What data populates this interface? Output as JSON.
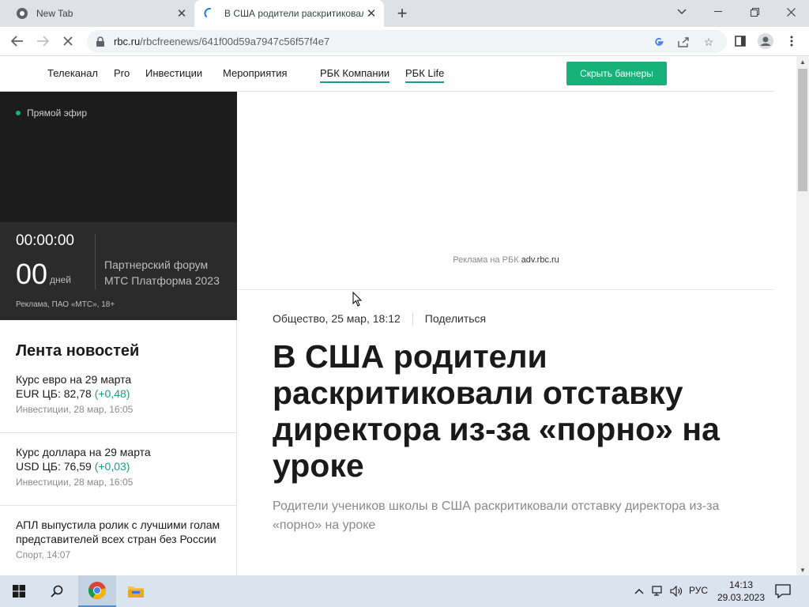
{
  "browser": {
    "tabs": [
      {
        "title": "New Tab",
        "active": false
      },
      {
        "title": "В США родители раскритиковали",
        "active": true
      }
    ],
    "url_host": "rbc.ru",
    "url_path": "/rbcfreenews/641f00d59a7947c56f57f4e7"
  },
  "site": {
    "nav": [
      "Телеканал",
      "Pro",
      "Инвестиции",
      "Мероприятия",
      "РБК Компании",
      "РБК Life"
    ],
    "hide_banners_label": "Скрыть баннеры",
    "live_label": "Прямой эфир",
    "countdown": {
      "time": "00:00:00",
      "days": "00",
      "days_label": "дней",
      "partner_line1": "Партнерский форум",
      "partner_line2": "МТС Платформа 2023",
      "ad_note": "Реклама, ПАО «МТС», 18+"
    },
    "feed_title": "Лента новостей",
    "feed": [
      {
        "line1": "Курс евро на 29 марта",
        "line2_main": "EUR ЦБ: 82,78",
        "line2_change": "(+0,48)",
        "meta": "Инвестиции, 28 мар, 16:05"
      },
      {
        "line1": "Курс доллара на 29 марта",
        "line2_main": "USD ЦБ: 76,59",
        "line2_change": "(+0,03)",
        "meta": "Инвестиции, 28 мар, 16:05"
      },
      {
        "line1": "АПЛ выпустила ролик с лучшими голам",
        "line2_main": "представителей всех стран без России",
        "line2_change": "",
        "meta": "Спорт, 14:07"
      }
    ],
    "ad_caption": "Реклама на РБК",
    "ad_link": "adv.rbc.ru",
    "article": {
      "category_date": "Общество, 25 мар, 18:12",
      "share_label": "Поделиться",
      "headline": "В США родители раскритиковали отставку директора из-за «порно» на уроке",
      "subtitle": "Родители учеников школы в США раскритиковали отставку директора из-за «порно» на уроке"
    }
  },
  "taskbar": {
    "language": "РУС",
    "time": "14:13",
    "date": "29.03.2023"
  },
  "colors": {
    "accent_green": "#16b27a",
    "dark_panel": "#1c1c1c"
  }
}
